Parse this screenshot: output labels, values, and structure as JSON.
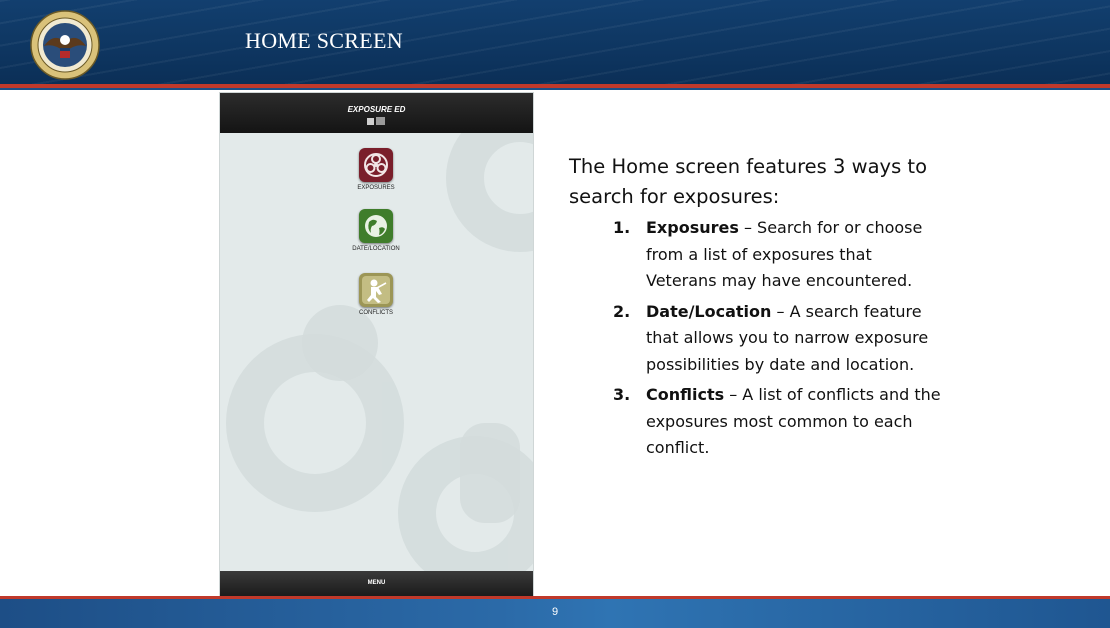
{
  "header": {
    "title": "HOME SCREEN"
  },
  "phone": {
    "app_title": "EXPOSURE ED",
    "menu": [
      {
        "label": "EXPOSURES",
        "icon": "biohazard-icon",
        "color": "#7a1f2b"
      },
      {
        "label": "DATE/LOCATION",
        "icon": "globe-icon",
        "color": "#3f7d2b"
      },
      {
        "label": "CONFLICTS",
        "icon": "soldier-icon",
        "color": "#9c9656"
      }
    ],
    "footer_label": "MENU"
  },
  "content": {
    "intro": "The Home screen features 3 ways to search for exposures:",
    "items": [
      {
        "num": "1.",
        "term": "Exposures",
        "desc": " – Search for or choose from a list of exposures that Veterans may have encountered."
      },
      {
        "num": "2.",
        "term": "Date/Location",
        "desc": " – A search feature that allows you to narrow exposure possibilities by date and location."
      },
      {
        "num": "3.",
        "term": "Conflicts",
        "desc": " – A list of conflicts and the exposures most common to each conflict."
      }
    ]
  },
  "footer": {
    "page": "9"
  },
  "colors": {
    "header_blue": "#0f3864",
    "accent_red": "#c0392b",
    "footer_blue": "#2b6aa8"
  }
}
